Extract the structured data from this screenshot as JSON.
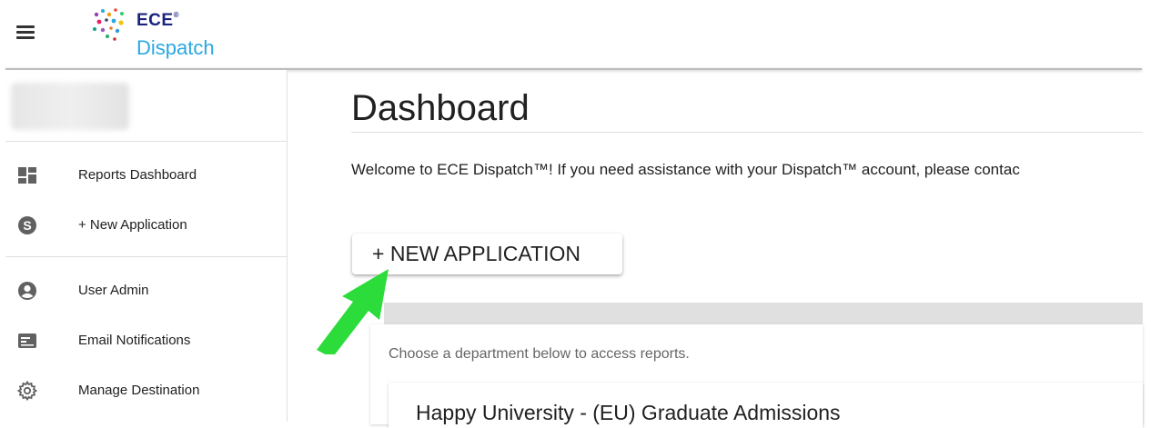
{
  "header": {
    "logo_top": "ECE",
    "logo_tm": "®",
    "logo_bottom": "Dispatch"
  },
  "sidebar": {
    "items": [
      {
        "label": "Reports Dashboard",
        "icon": "dashboard-icon"
      },
      {
        "label": "+ New Application",
        "icon": "dollar-circle-icon"
      },
      {
        "label": "User Admin",
        "icon": "account-circle-icon"
      },
      {
        "label": "Email Notifications",
        "icon": "email-card-icon"
      },
      {
        "label": "Manage Destination",
        "icon": "gear-icon"
      }
    ]
  },
  "main": {
    "title": "Dashboard",
    "welcome": "Welcome to ECE Dispatch™! If you need assistance with your Dispatch™ account, please contac",
    "new_application_label": "+ NEW APPLICATION",
    "choose_text": "Choose a department below to access reports.",
    "department_title": "Happy University - (EU) Graduate Admissions"
  },
  "colors": {
    "logo_navy": "#1a237e",
    "logo_blue": "#29a8e0",
    "annotation_arrow": "#2bdc3a"
  }
}
